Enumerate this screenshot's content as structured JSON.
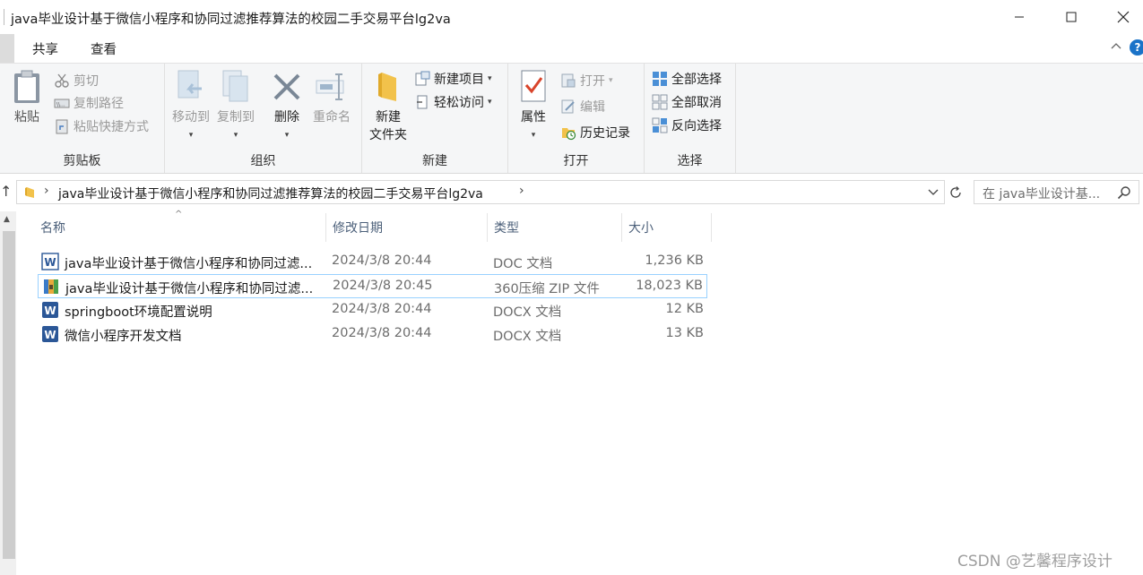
{
  "window": {
    "title": "java毕业设计基于微信小程序和协同过滤推荐算法的校园二手交易平台lg2va"
  },
  "tabs": {
    "share": "共享",
    "view": "查看"
  },
  "ribbon": {
    "clipboard": {
      "label": "剪贴板",
      "paste": "粘贴",
      "cut": "剪切",
      "copy_path": "复制路径",
      "paste_shortcut": "粘贴快捷方式"
    },
    "organize": {
      "label": "组织",
      "move_to": "移动到",
      "copy_to": "复制到",
      "delete": "删除",
      "rename": "重命名"
    },
    "new": {
      "label": "新建",
      "new_folder_line1": "新建",
      "new_folder_line2": "文件夹",
      "new_item": "新建项目",
      "easy_access": "轻松访问"
    },
    "open": {
      "label": "打开",
      "properties": "属性",
      "open": "打开",
      "edit": "编辑",
      "history": "历史记录"
    },
    "select": {
      "label": "选择",
      "select_all": "全部选择",
      "select_none": "全部取消",
      "invert": "反向选择"
    }
  },
  "address": {
    "path": "java毕业设计基于微信小程序和协同过滤推荐算法的校园二手交易平台lg2va",
    "search_placeholder": "在 java毕业设计基..."
  },
  "columns": {
    "name": "名称",
    "modified": "修改日期",
    "type": "类型",
    "size": "大小"
  },
  "files": [
    {
      "name": "java毕业设计基于微信小程序和协同过滤...",
      "modified": "2024/3/8 20:44",
      "type": "DOC 文档",
      "size": "1,236 KB",
      "icon": "word-doc-icon"
    },
    {
      "name": "java毕业设计基于微信小程序和协同过滤...",
      "modified": "2024/3/8 20:45",
      "type": "360压缩 ZIP 文件",
      "size": "18,023 KB",
      "icon": "zip-archive-icon"
    },
    {
      "name": "springboot环境配置说明",
      "modified": "2024/3/8 20:44",
      "type": "DOCX 文档",
      "size": "12 KB",
      "icon": "word-docx-icon"
    },
    {
      "name": "微信小程序开发文档",
      "modified": "2024/3/8 20:44",
      "type": "DOCX 文档",
      "size": "13 KB",
      "icon": "word-docx-icon"
    }
  ],
  "watermark": "CSDN @艺馨程序设计",
  "colors": {
    "accent": "#1a73c8",
    "selection_border": "#99d1ff",
    "folder": "#f2c24b"
  }
}
